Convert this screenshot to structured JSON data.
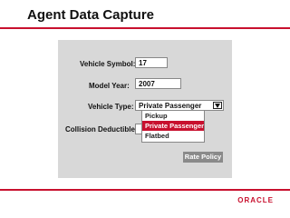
{
  "page": {
    "title": "Agent Data Capture"
  },
  "form": {
    "vehicle_symbol_label": "Vehicle Symbol:",
    "vehicle_symbol_value": "17",
    "model_year_label": "Model Year:",
    "model_year_value": "2007",
    "vehicle_type_label": "Vehicle Type:",
    "vehicle_type_value": "Private Passenger",
    "collision_deductible_label": "Collision Deductible:",
    "vehicle_type_options": [
      "Pickup",
      "Private Passenger",
      "Flatbed"
    ],
    "rate_policy_label": "Rate Policy"
  },
  "footer": {
    "logo_text": "ORACLE"
  },
  "colors": {
    "accent": "#c8102e",
    "panel": "#d8d8d8",
    "button": "#8a8a8a"
  },
  "icons": {
    "dropdown_arrow": "chevron-down-icon"
  }
}
